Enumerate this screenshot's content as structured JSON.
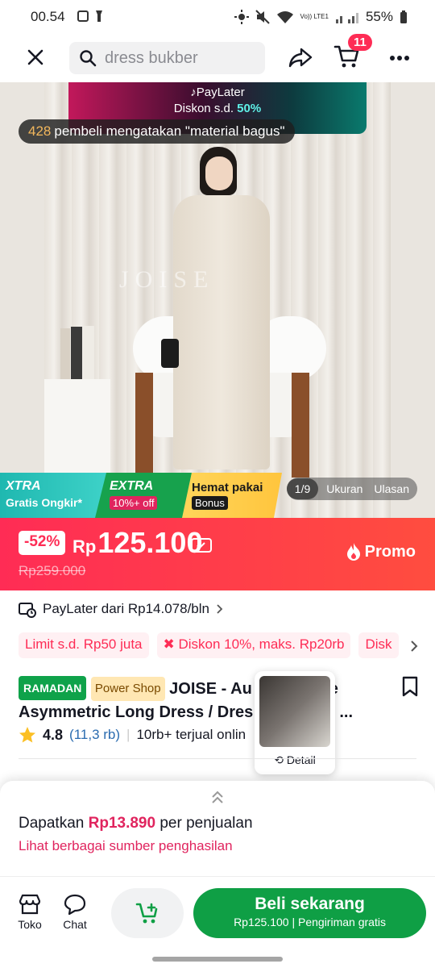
{
  "status": {
    "time": "00.54",
    "battery": "55%",
    "network": "Vo)) LTE1"
  },
  "topbar": {
    "search_placeholder": "dress bukber",
    "cart_count": "11"
  },
  "hero": {
    "paylater_brand": "PayLater",
    "paylater_discount_label": "Diskon s.d.",
    "paylater_discount_value": "50%",
    "buyer_count": "428",
    "buyer_text": "pembeli mengatakan \"material bagus\"",
    "watermark": "JOISE",
    "pager": "1/9",
    "tab_size": "Ukuran",
    "tab_review": "Ulasan"
  },
  "strip": {
    "xtra_title": "XTRA",
    "xtra_sub": "Gratis Ongkir*",
    "extra_title": "EXTRA",
    "extra_sub": "10%+ off",
    "hemat_title": "Hemat pakai",
    "hemat_sub": "Bonus"
  },
  "price": {
    "discount": "-52%",
    "currency": "Rp",
    "amount": "125.100",
    "original": "Rp259.000",
    "promo_label": "Promo"
  },
  "paylater_row": {
    "text": "PayLater dari Rp14.078/bln"
  },
  "chips": [
    "Limit s.d. Rp50 juta",
    "Diskon 10%, maks. Rp20rb",
    "Disk"
  ],
  "product": {
    "tag_ramadan": "RAMADAN",
    "tag_power": "Power Shop",
    "title_line1": "JOISE - Au",
    "title_line1_tail": "e",
    "title_line2": "Asymmetric Long Dress / Dres",
    "title_line2_tail": "l ...",
    "rating": "4.8",
    "rating_count": "(11,3 rb)",
    "sold": "10rb+ terjual onlin",
    "thumb_label": "Detail"
  },
  "earn": {
    "line1_prefix": "Dapatkan",
    "line1_amount": "Rp13.890",
    "line1_suffix": "per penjualan",
    "line2": "Lihat berbagai sumber penghasilan"
  },
  "bottom": {
    "shop_label": "Toko",
    "chat_label": "Chat",
    "buy_label": "Beli sekarang",
    "buy_price": "Rp125.100",
    "buy_shipping": "Pengiriman gratis"
  },
  "colors": {
    "accent": "#fe2c55",
    "buy": "#0f9f45",
    "price_bg": "#ff3b4e"
  }
}
